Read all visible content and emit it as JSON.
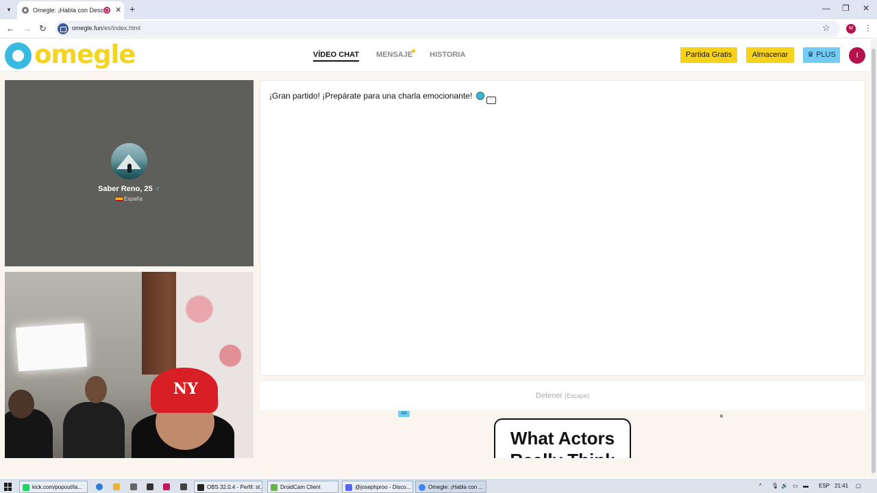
{
  "browser": {
    "tab_title": "Omegle: ¡Habla con Desconocidos!",
    "new_tab": "+",
    "url_host": "omegle.fun",
    "url_path": "/es/index.html",
    "profile_initial": "M",
    "window_controls": [
      "—",
      "❐",
      "✕"
    ]
  },
  "site": {
    "logo_text": "omegle",
    "nav": [
      {
        "label": "VÍDEO CHAT",
        "active": true
      },
      {
        "label": "MENSAJE",
        "active": false
      },
      {
        "label": "HISTORIA",
        "active": false
      }
    ],
    "buttons": {
      "free_match": "Partida Gratis",
      "store": "Almacenar",
      "plus": "♛ PLUS"
    },
    "user_initial": "I"
  },
  "stranger": {
    "name": "Saber Reno, 25",
    "gender_icon": "♂",
    "country": "España"
  },
  "chat": {
    "message": "¡Gran partido! ¡Prepárate para una charla emocionante!",
    "stop_label": "Detener",
    "stop_hint": "(Escape)"
  },
  "ad": {
    "badge": "AD",
    "close": "×",
    "headline_line1": "What Actors",
    "headline_line2": "Really Think"
  },
  "taskbar": {
    "items": [
      {
        "label": "kick.com/popout/la...",
        "color": "#1ed760"
      },
      {
        "label": "OBS 32.0.4 - Perfil: st...",
        "color": "#222222"
      },
      {
        "label": "DroidCam Client",
        "color": "#6ab04c"
      },
      {
        "label": "@josephproo - Disco...",
        "color": "#5865f2"
      },
      {
        "label": "Omegle: ¡Habla con ...",
        "color": "#4285f4"
      }
    ],
    "lang": "ESP",
    "time": "21:41"
  }
}
